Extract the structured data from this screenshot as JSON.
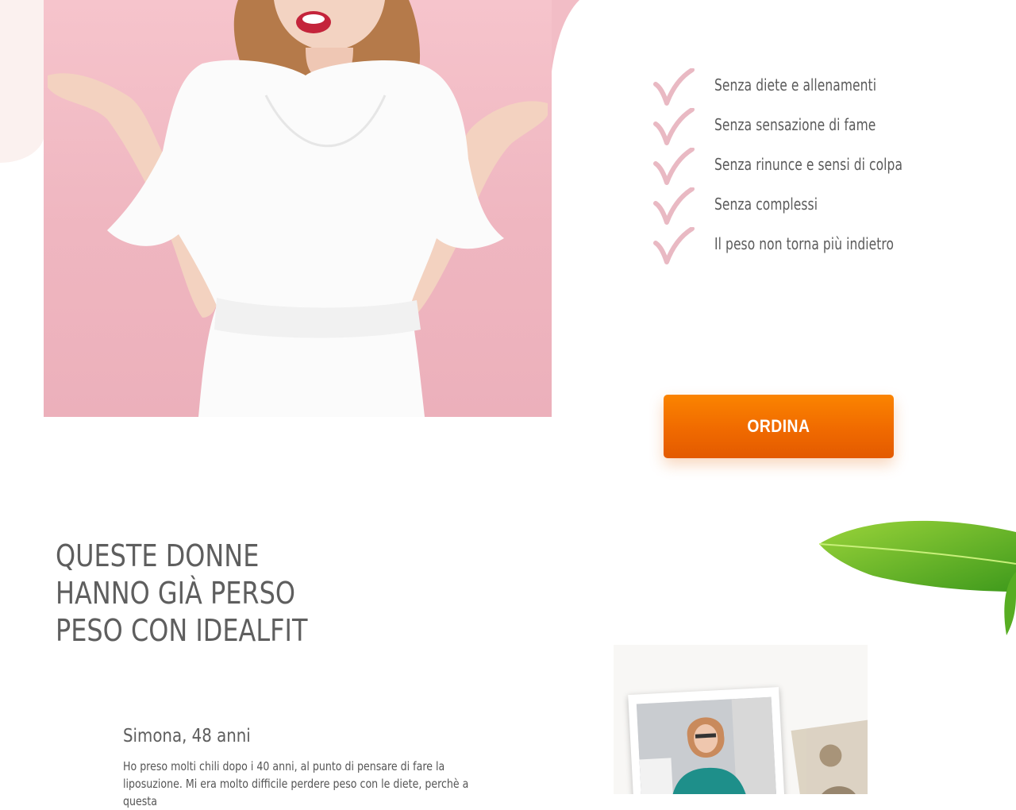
{
  "benefits": [
    "Senza diete e allenamenti",
    "Senza sensazione di fame",
    "Senza rinunce e sensi di colpa",
    "Senza complessi",
    "Il peso non torna più indietro"
  ],
  "cta": {
    "label": "ORDINA"
  },
  "testimonials_section": {
    "title_lines": [
      "QUESTE DONNE",
      "HANNO GIÀ PERSO",
      "PESO CON IDEALFIT"
    ]
  },
  "testimonial": {
    "name": "Simona, 48 anni",
    "text_lines": [
      "Ho preso molti chili dopo i 40 anni, al punto di pensare di fare la",
      "liposuzione. Mi era molto difficile perdere peso con le diete, perchè a questa"
    ]
  },
  "colors": {
    "accent": "#f37200",
    "check": "#e9b9c3",
    "heroBg": "#f2bdc6"
  }
}
